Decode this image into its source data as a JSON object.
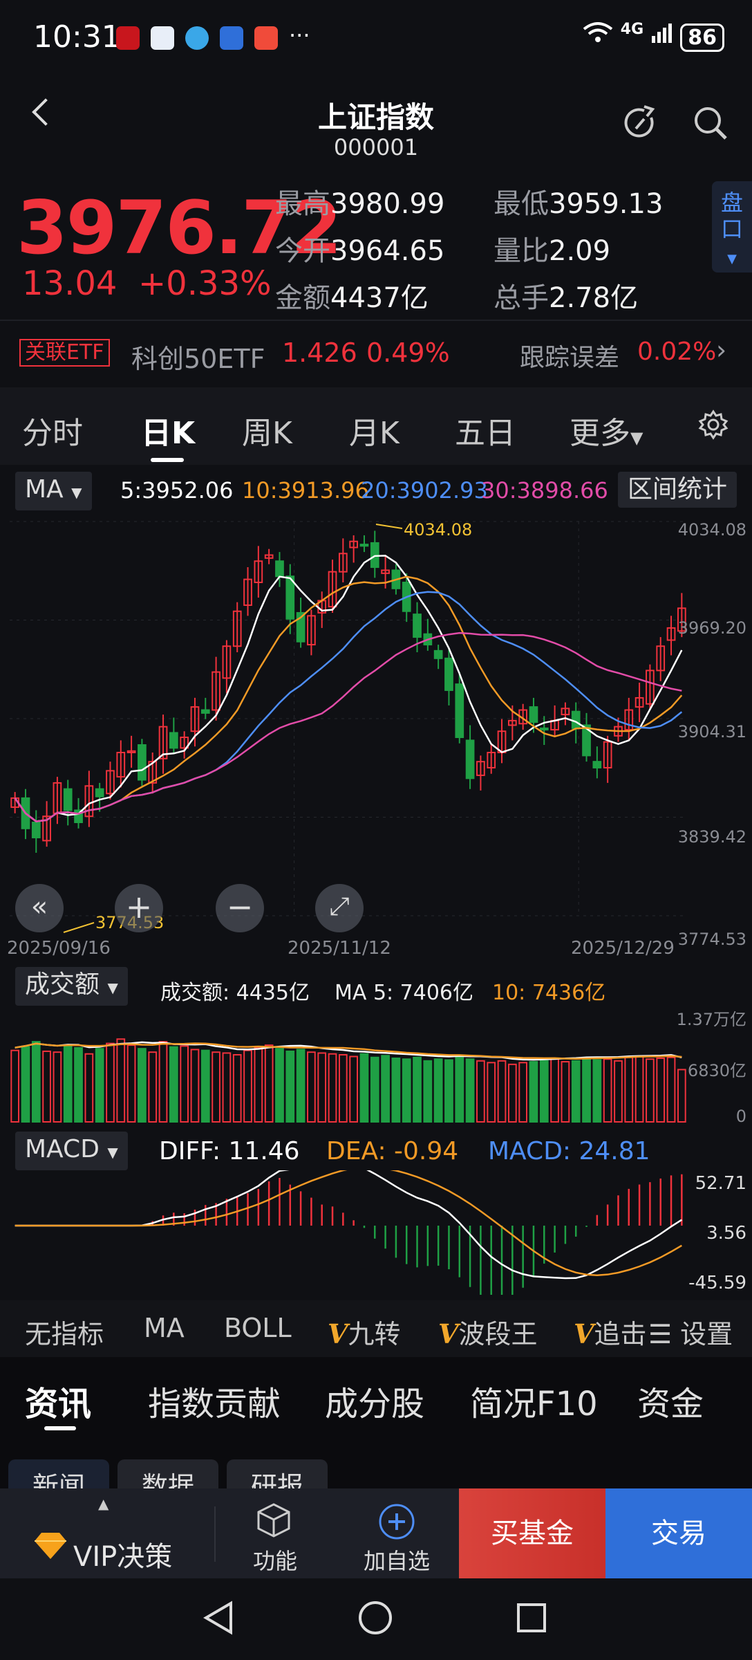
{
  "status_bar": {
    "time": "10:31",
    "dots": "···",
    "network": "4G",
    "battery": "86"
  },
  "header": {
    "title": "上证指数",
    "code": "000001"
  },
  "quote": {
    "price": "3976.72",
    "change": "13.04",
    "change_pct": "+0.33%",
    "high_label": "最高",
    "high": "3980.99",
    "low_label": "最低",
    "low": "3959.13",
    "open_label": "今开",
    "open": "3964.65",
    "volratio_label": "量比",
    "volratio": "2.09",
    "amount_label": "金额",
    "amount": "4437亿",
    "hands_label": "总手",
    "hands": "2.78亿",
    "pankou": "盘口"
  },
  "etf": {
    "tag": "关联ETF",
    "name": "科创50ETF",
    "price": "1.426",
    "pct": "0.49%",
    "tracking_label": "跟踪误差",
    "tracking": "0.02%"
  },
  "period_tabs": [
    "分时",
    "日K",
    "周K",
    "月K",
    "五日",
    "更多"
  ],
  "ma_row": {
    "selector": "MA",
    "ma5": "5:3952.06",
    "ma10": "10:3913.96",
    "ma20": "20:3902.93",
    "ma30": "30:3898.66",
    "range_stats": "区间统计"
  },
  "kchart_axis": {
    "y_ticks": [
      "4034.08",
      "3969.20",
      "3904.31",
      "3839.42",
      "3774.53"
    ],
    "x_ticks": [
      "2025/09/16",
      "2025/11/12",
      "2025/12/29"
    ],
    "max_label": "4034.08",
    "min_label": "3774.53"
  },
  "volume": {
    "selector": "成交额",
    "amount_text": "成交额: 4435亿",
    "ma5_text": "MA 5: 7406亿",
    "ma10_text": "10: 7436亿",
    "y_ticks": [
      "1.37万亿",
      "6830亿",
      "0"
    ]
  },
  "macd": {
    "selector": "MACD",
    "diff": "DIFF: 11.46",
    "dea": "DEA: -0.94",
    "macd": "MACD: 24.81",
    "y_ticks": [
      "52.71",
      "3.56",
      "-45.59"
    ]
  },
  "indicators": [
    "无指标",
    "MA",
    "BOLL",
    "九转",
    "波段王",
    "追击",
    "设置"
  ],
  "news_tabs": [
    "资讯",
    "指数贡献",
    "成分股",
    "简况F10",
    "资金"
  ],
  "sub_tabs": [
    "新闻",
    "数据",
    "研报"
  ],
  "action_bar": {
    "vip": "VIP决策",
    "func": "功能",
    "add": "加自选",
    "buy_fund": "买基金",
    "trade": "交易"
  },
  "colors": {
    "up": "#f0323c",
    "down": "#1fa045",
    "ma5": "#ffffff",
    "ma10": "#f29a26",
    "ma20": "#4e8ef7",
    "ma30": "#e24ca8"
  },
  "chart_data": [
    {
      "type": "candlestick",
      "title": "",
      "x_ticks": [
        "2025/09/16",
        "2025/11/12",
        "2025/12/29"
      ],
      "ylim": [
        3774.53,
        4034.08
      ],
      "y_ticks": [
        4034.08,
        3969.2,
        3904.31,
        3839.42,
        3774.53
      ],
      "series": [
        {
          "name": "5",
          "last": 3952.06
        },
        {
          "name": "10",
          "last": 3913.96
        },
        {
          "name": "20",
          "last": 3902.93
        },
        {
          "name": "30",
          "last": 3898.66
        }
      ],
      "closes": [
        3852,
        3832,
        3826,
        3840,
        3862,
        3844,
        3836,
        3860,
        3853,
        3870,
        3882,
        3883,
        3864,
        3876,
        3899,
        3885,
        3892,
        3912,
        3908,
        3935,
        3952,
        3975,
        3996,
        4008,
        4012,
        3998,
        3970,
        3955,
        3972,
        3982,
        4001,
        4013,
        4021,
        4018,
        4004,
        4002,
        3990,
        3975,
        3958,
        3953,
        3944,
        3923,
        3892,
        3865,
        3876,
        3882,
        3896,
        3903,
        3910,
        3902,
        3897,
        3903,
        3911,
        3898,
        3880,
        3872,
        3889,
        3899,
        3910,
        3918,
        3936,
        3952,
        3964,
        3977
      ],
      "max": 4034.08,
      "min": 3774.53
    },
    {
      "type": "bar",
      "title": "",
      "ylabel": "成交额",
      "y_ticks": [
        "1.37万亿",
        "6830亿",
        "0"
      ],
      "values_rel": [
        0.82,
        0.86,
        0.92,
        0.81,
        0.8,
        0.88,
        0.85,
        0.78,
        0.84,
        0.9,
        0.95,
        0.88,
        0.84,
        0.8,
        0.92,
        0.86,
        0.87,
        0.83,
        0.82,
        0.8,
        0.79,
        0.77,
        0.82,
        0.85,
        0.88,
        0.84,
        0.81,
        0.83,
        0.8,
        0.79,
        0.78,
        0.77,
        0.75,
        0.78,
        0.74,
        0.76,
        0.73,
        0.72,
        0.74,
        0.7,
        0.72,
        0.71,
        0.75,
        0.72,
        0.7,
        0.68,
        0.7,
        0.66,
        0.68,
        0.69,
        0.7,
        0.72,
        0.69,
        0.7,
        0.73,
        0.71,
        0.72,
        0.7,
        0.74,
        0.75,
        0.72,
        0.73,
        0.74,
        0.6
      ]
    },
    {
      "type": "bar",
      "title": "",
      "ylabel": "MACD",
      "y_ticks": [
        "52.71",
        "3.56",
        "-45.59"
      ],
      "diff": 11.46,
      "dea": -0.94,
      "macd": 24.81
    }
  ]
}
